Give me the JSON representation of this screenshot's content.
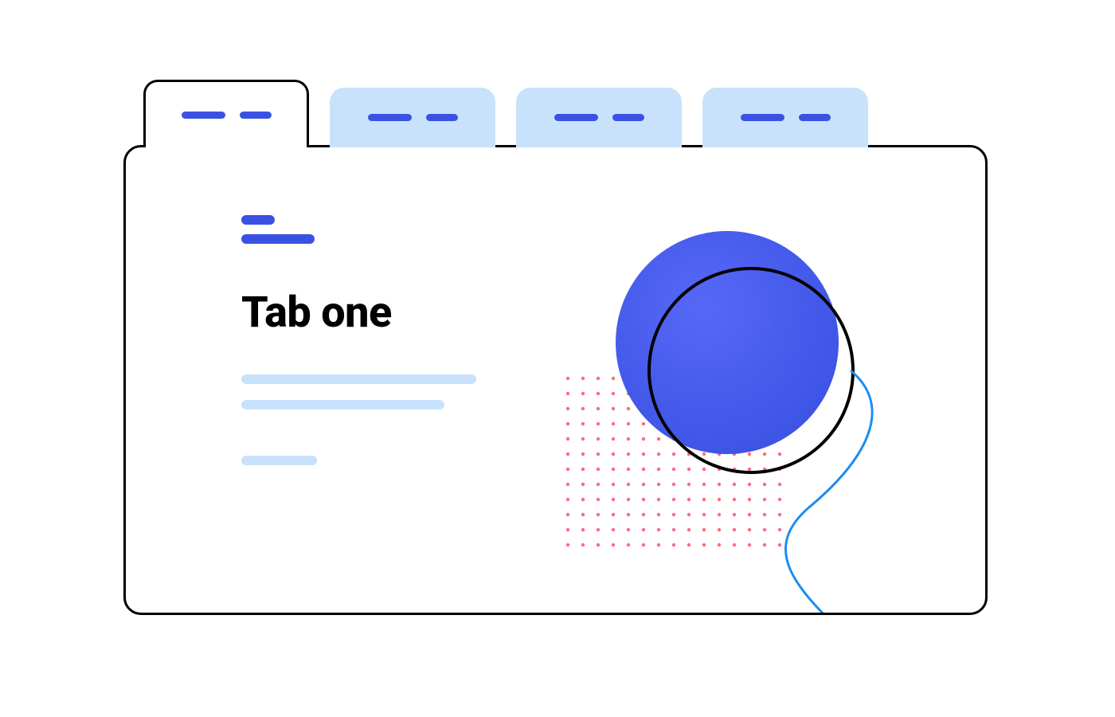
{
  "tabs": [
    {
      "id": "tab-one",
      "active": true
    },
    {
      "id": "tab-two",
      "active": false
    },
    {
      "id": "tab-three",
      "active": false
    },
    {
      "id": "tab-four",
      "active": false
    }
  ],
  "content": {
    "heading": "Tab one"
  },
  "colors": {
    "accent": "#3a52e3",
    "soft": "#c9e2fb",
    "dots": "#ff6a7a",
    "line": "#1a8df0"
  }
}
